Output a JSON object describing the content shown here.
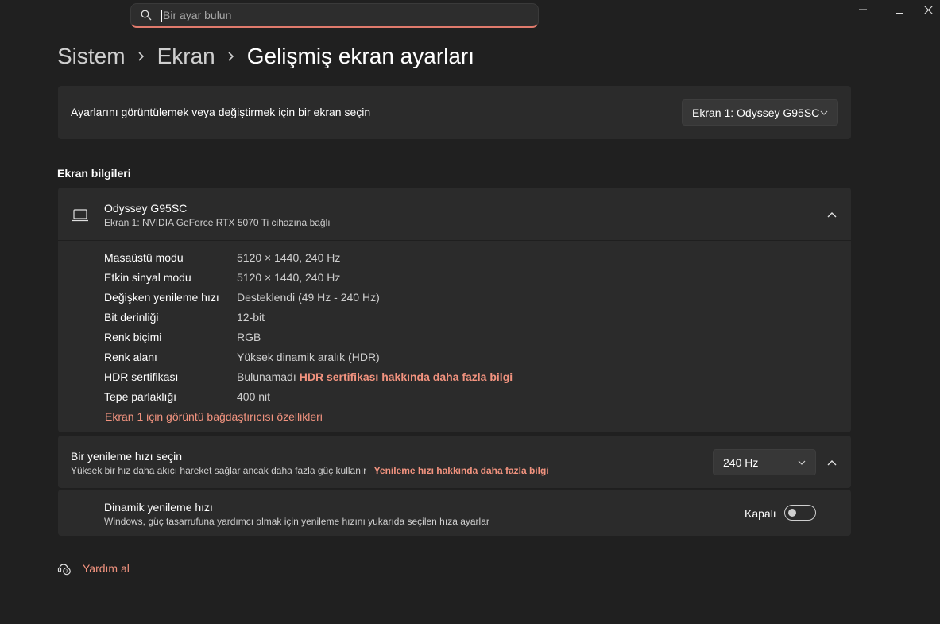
{
  "search": {
    "placeholder": "Bir ayar bulun",
    "value": ""
  },
  "window_controls": {
    "minimize_icon": "minimize-icon",
    "maximize_icon": "maximize-icon",
    "close_icon": "close-icon"
  },
  "breadcrumb": {
    "items": [
      "Sistem",
      "Ekran"
    ],
    "current": "Gelişmiş ekran ayarları"
  },
  "display_select": {
    "label": "Ayarlarını görüntülemek veya değiştirmek için bir ekran seçin",
    "selected": "Ekran 1: Odyssey G95SC"
  },
  "display_info": {
    "section_title": "Ekran bilgileri",
    "monitor_name": "Odyssey G95SC",
    "monitor_sub": "Ekran 1: NVIDIA GeForce RTX 5070 Ti cihazına bağlı",
    "rows": [
      {
        "key": "Masaüstü modu",
        "value": "5120 × 1440, 240 Hz"
      },
      {
        "key": "Etkin sinyal modu",
        "value": "5120 × 1440, 240 Hz"
      },
      {
        "key": "Değişken yenileme hızı",
        "value": "Desteklendi (49 Hz - 240 Hz)"
      },
      {
        "key": "Bit derinliği",
        "value": "12-bit"
      },
      {
        "key": "Renk biçimi",
        "value": "RGB"
      },
      {
        "key": "Renk alanı",
        "value": "Yüksek dinamik aralık (HDR)"
      },
      {
        "key": "HDR sertifikası",
        "value": "Bulunamadı",
        "link": "HDR sertifikası hakkında daha fazla bilgi"
      },
      {
        "key": "Tepe parlaklığı",
        "value": "400 nit"
      }
    ],
    "adapter_link": "Ekran 1 için görüntü bağdaştırıcısı özellikleri"
  },
  "refresh_rate": {
    "title": "Bir yenileme hızı seçin",
    "subtitle": "Yüksek bir hız daha akıcı hareket sağlar ancak daha fazla güç kullanır",
    "link": "Yenileme hızı hakkında daha fazla bilgi",
    "selected": "240 Hz"
  },
  "dynamic_refresh": {
    "title": "Dinamik yenileme hızı",
    "subtitle": "Windows, güç tasarrufuna yardımcı olmak için yenileme hızını yukarıda seçilen hıza ayarlar",
    "toggle_label": "Kapalı",
    "toggle_on": false
  },
  "help": {
    "label": "Yardım al"
  },
  "colors": {
    "background": "#202020",
    "card": "#2b2b2b",
    "accent": "#f2937f"
  }
}
